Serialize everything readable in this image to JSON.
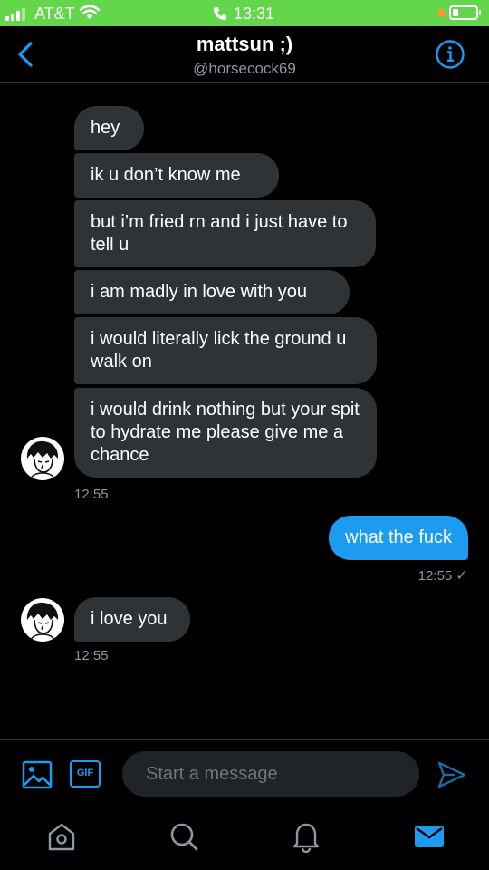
{
  "status_bar": {
    "carrier": "AT&T",
    "time": "13:31",
    "battery_level": 0.2,
    "background": "#64d64b"
  },
  "header": {
    "title": "mattsun ;)",
    "handle": "@horsecock69",
    "back_icon": "chevron-left-icon",
    "info_icon": "info-circle-icon"
  },
  "conversation": {
    "incoming_group_1": [
      "hey",
      "ik u don’t know me",
      "but i’m fried rn and i just have to tell u",
      "i am madly in love with you",
      "i would literally lick the ground u walk on",
      "i would drink nothing but your spit to hydrate me please give me a chance"
    ],
    "incoming_group_1_time": "12:55",
    "outgoing": "what the fuck",
    "outgoing_time": "12:55 ✓",
    "incoming_group_2": [
      "i love you"
    ],
    "incoming_group_2_time": "12:55"
  },
  "composer": {
    "placeholder": "Start a message",
    "gif_label": "GIF"
  },
  "tabbar": {
    "items": [
      "home-icon",
      "search-icon",
      "notifications-icon",
      "messages-icon"
    ],
    "active": "messages-icon"
  },
  "colors": {
    "accent": "#1d9bf0",
    "incoming_bubble": "#2f3336",
    "background": "#000000"
  }
}
